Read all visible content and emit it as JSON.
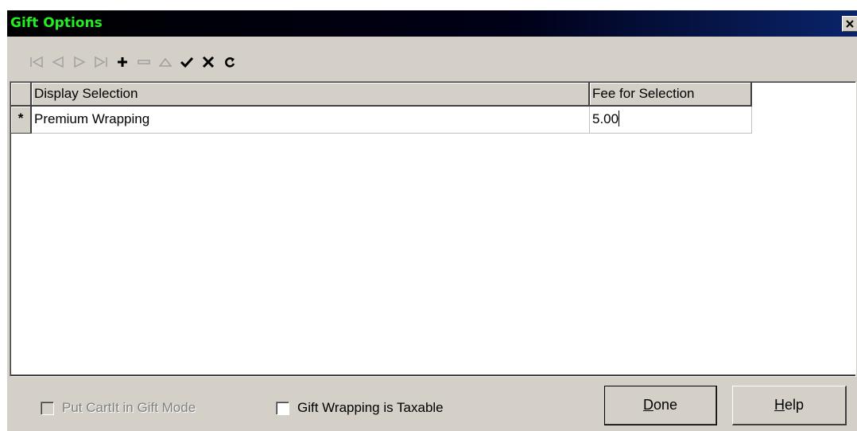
{
  "window": {
    "title": "Gift Options",
    "close_glyph": "✕"
  },
  "toolbar": {
    "buttons": [
      {
        "icon": "first-record-icon",
        "enabled": false
      },
      {
        "icon": "prior-record-icon",
        "enabled": false
      },
      {
        "icon": "next-record-icon",
        "enabled": false
      },
      {
        "icon": "last-record-icon",
        "enabled": false
      },
      {
        "icon": "insert-record-icon",
        "enabled": true
      },
      {
        "icon": "delete-record-icon",
        "enabled": false
      },
      {
        "icon": "edit-record-icon",
        "enabled": false
      },
      {
        "icon": "post-edit-icon",
        "enabled": true
      },
      {
        "icon": "cancel-edit-icon",
        "enabled": true
      },
      {
        "icon": "refresh-data-icon",
        "enabled": true
      }
    ]
  },
  "grid": {
    "columns": [
      "Display Selection",
      "Fee for Selection"
    ],
    "rows": [
      {
        "indicator": "*",
        "display_selection": "Premium Wrapping",
        "fee": "5.00"
      }
    ]
  },
  "options": {
    "gift_mode_label": "Put CartIt in Gift Mode",
    "gift_mode_checked": false,
    "gift_mode_enabled": false,
    "taxable_label": "Gift Wrapping is Taxable",
    "taxable_checked": false
  },
  "buttons": {
    "done_first": "D",
    "done_rest": "one",
    "help_first": "H",
    "help_rest": "elp"
  },
  "colors": {
    "title_text": "#22ee22",
    "face": "#d4d0c8",
    "toolbar_active": "#000000",
    "toolbar_disabled": "#a0a0a0"
  }
}
